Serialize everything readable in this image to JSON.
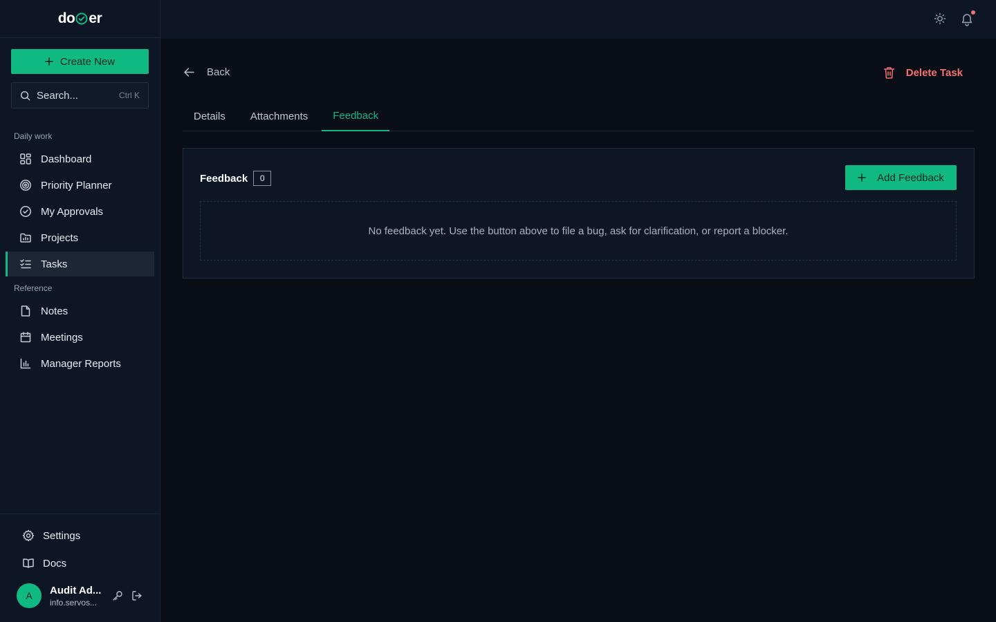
{
  "app": {
    "logo_left": "do",
    "logo_right": "er"
  },
  "sidebar": {
    "create_label": "Create New",
    "search_placeholder": "Search...",
    "search_shortcut": "Ctrl K",
    "sections": {
      "daily": "Daily work",
      "reference": "Reference"
    },
    "items": [
      {
        "label": "Dashboard",
        "icon": "dashboard-icon"
      },
      {
        "label": "Priority Planner",
        "icon": "target-icon"
      },
      {
        "label": "My Approvals",
        "icon": "check-circle-icon"
      },
      {
        "label": "Projects",
        "icon": "folder-chart-icon"
      },
      {
        "label": "Tasks",
        "icon": "list-check-icon",
        "active": true
      },
      {
        "label": "Notes",
        "icon": "file-icon"
      },
      {
        "label": "Meetings",
        "icon": "calendar-icon"
      },
      {
        "label": "Manager Reports",
        "icon": "bar-chart-icon"
      }
    ],
    "bottom": {
      "settings": "Settings",
      "docs": "Docs"
    },
    "user": {
      "initial": "A",
      "name": "Audit Ad...",
      "email": "info.servos..."
    }
  },
  "header": {
    "back_label": "Back",
    "delete_label": "Delete Task"
  },
  "tabs": [
    {
      "label": "Details"
    },
    {
      "label": "Attachments"
    },
    {
      "label": "Feedback",
      "active": true
    }
  ],
  "feedback": {
    "title": "Feedback",
    "count": "0",
    "add_label": "Add Feedback",
    "empty_message": "No feedback yet. Use the button above to file a bug, ask for clarification, or report a blocker."
  },
  "colors": {
    "accent": "#10b981",
    "danger": "#f87171",
    "background": "#090d16",
    "panel": "#0e1626"
  }
}
